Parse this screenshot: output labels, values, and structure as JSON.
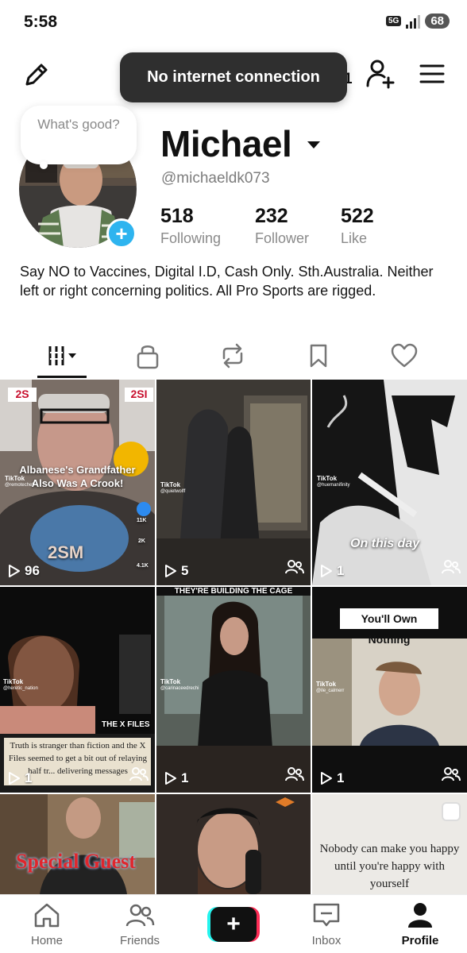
{
  "status_bar": {
    "time": "5:58",
    "network": "5G",
    "battery": "68"
  },
  "toast": {
    "message": "No internet connection"
  },
  "top_nav": {
    "pencil_icon": "pencil-icon",
    "friend_count_partial": "1",
    "add_friend_icon": "add-friend-icon",
    "menu_icon": "hamburger-menu-icon"
  },
  "profile": {
    "note": "What's good?",
    "name": "Michael",
    "handle": "@michaeldk073",
    "stats": {
      "following_count": "518",
      "following_label": "Following",
      "follower_count": "232",
      "follower_label": "Follower",
      "like_count": "522",
      "like_label": "Like"
    },
    "bio": "Say NO to Vaccines, Digital I.D, Cash Only. Sth.Australia. Neither left or right concerning politics. All Pro Sports are rigged."
  },
  "tabs": [
    {
      "name": "videos",
      "icon": "grid-columns-icon",
      "active": true
    },
    {
      "name": "private",
      "icon": "lock-icon"
    },
    {
      "name": "reposts",
      "icon": "repost-icon"
    },
    {
      "name": "favorites",
      "icon": "bookmark-icon"
    },
    {
      "name": "liked",
      "icon": "heart-icon"
    }
  ],
  "videos": [
    {
      "views": "96",
      "caption": "Albanese's Grandfather Also Was A Crook!",
      "tiktok": "TikTok",
      "author": "@remotechef",
      "overlay_likes": "11K",
      "overlay_comments": "2K",
      "overlay_shares": "4.1K",
      "badge_left": "2S",
      "badge_right": "2SI",
      "emblem": "2SM",
      "collab": false
    },
    {
      "views": "5",
      "tiktok": "TikTok",
      "author": "@quietwolff",
      "collab": true
    },
    {
      "views": "1",
      "tiktok": "TikTok",
      "author": "@huemanifinity",
      "caption": "On this day",
      "collab": true
    },
    {
      "views": "1",
      "tiktok": "TikTok",
      "author": "@heretic_nation",
      "logo": "THE X FILES",
      "caption": "Truth is stranger than fiction and the X Files seemed to get a bit out of relaying half tr... delivering messages",
      "collab": true
    },
    {
      "views": "1",
      "tiktok": "TikTok",
      "author": "@carinaceedrechi",
      "top_text": "THEY'RE BUILDING THE CAGE",
      "collab": true
    },
    {
      "views": "1",
      "tiktok": "TikTok",
      "author": "@ile_calmerr",
      "caption": "You'll Own Nothing",
      "collab": true
    },
    {
      "caption": "Special Guest"
    },
    {},
    {
      "caption": "Nobody can make you happy until you're happy with yourself"
    }
  ],
  "bottom_nav": {
    "home": "Home",
    "friends": "Friends",
    "inbox": "Inbox",
    "profile": "Profile"
  },
  "colors": {
    "accent_blue": "#2eb4ef",
    "tiktok_cyan": "#25f4ee",
    "tiktok_red": "#fe2c55",
    "toast_bg": "#2f2f2f"
  }
}
